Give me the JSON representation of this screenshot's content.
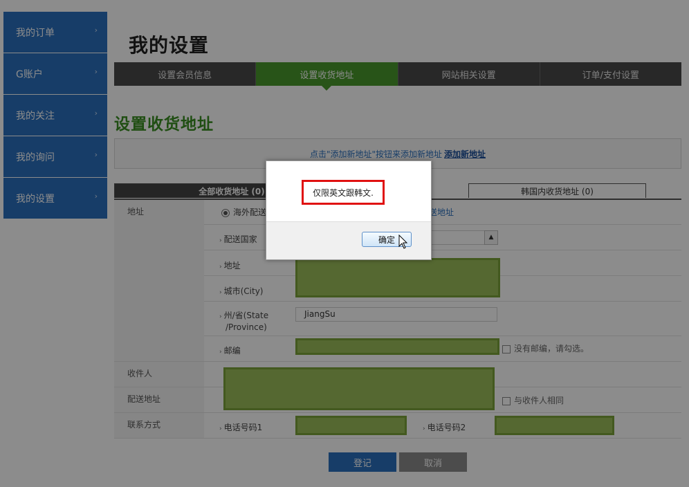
{
  "sidebar": {
    "items": [
      {
        "label": "我的订单"
      },
      {
        "label": "G账户"
      },
      {
        "label": "我的关注"
      },
      {
        "label": "我的询问"
      },
      {
        "label": "我的设置"
      }
    ]
  },
  "page": {
    "title": "我的设置"
  },
  "tabs": [
    {
      "label": "设置会员信息"
    },
    {
      "label": "设置收货地址"
    },
    {
      "label": "网站相关设置"
    },
    {
      "label": "订单/支付设置"
    }
  ],
  "section": {
    "title": "设置收货地址"
  },
  "hint": {
    "text": "点击\"添加新地址\"按钮来添加新地址",
    "link": "添加新地址"
  },
  "address_tabs": {
    "all": "全部收货地址 (0)",
    "korea": "韩国内收货地址 (0)"
  },
  "form": {
    "address_label": "地址",
    "overseas_option": "海外配送",
    "korea_option_tail": "送地址",
    "country_label": "配送国家",
    "address_sub_label": "地址",
    "city_label": "城市(City)",
    "state_label_line1": "州/省(State",
    "state_label_line2": "/Province)",
    "state_value": "JiangSu",
    "zip_label": "邮编",
    "no_zip_label": "没有邮编，请勾选。",
    "recipient_label": "收件人",
    "ship_address_label": "配送地址",
    "same_as_recipient": "与收件人相同",
    "contact_label": "联系方式",
    "phone1_label": "电话号码1",
    "phone2_label": "电话号码2"
  },
  "buttons": {
    "register": "登记",
    "cancel": "取消"
  },
  "dialog": {
    "message": "仅限英文跟韩文.",
    "ok": "确定"
  }
}
